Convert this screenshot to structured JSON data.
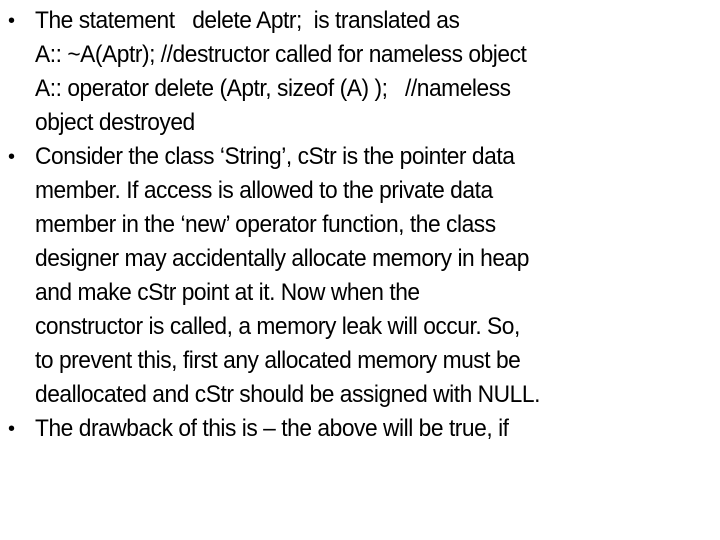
{
  "slide": {
    "bullets": [
      {
        "lines": [
          "The statement   delete Aptr;  is translated as",
          "A:: ~A(Aptr); //destructor called for nameless object",
          "A:: operator delete (Aptr, sizeof (A) );   //nameless",
          "object destroyed"
        ]
      },
      {
        "lines": [
          "Consider the class ‘String’, cStr is the pointer data",
          "member. If access is allowed to the private data",
          "member in the ‘new’ operator function, the class",
          "designer may accidentally allocate memory in heap",
          "and make cStr point at it. Now when the",
          "constructor is called, a memory leak will occur. So,",
          "to prevent this, first any allocated memory must be",
          "deallocated and cStr should be assigned with NULL."
        ]
      },
      {
        "lines": [
          "The drawback of this is – the above will be true, if"
        ]
      }
    ],
    "bullet_glyph": "•"
  }
}
